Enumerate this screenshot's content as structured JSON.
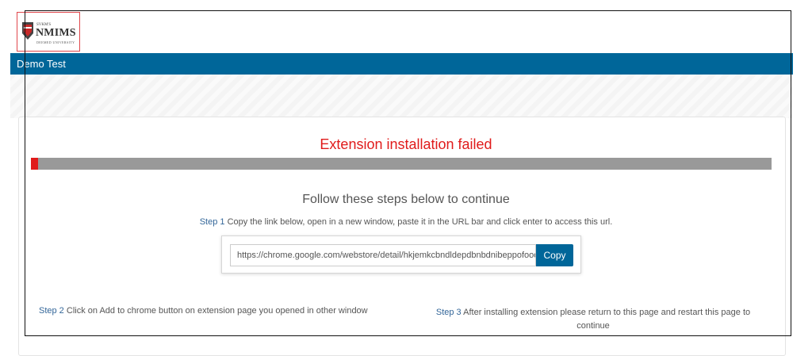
{
  "logo": {
    "small_text": "SVKM'S",
    "name": "NMIMS",
    "subtitle": "DEEMED UNIVERSITY"
  },
  "header": {
    "title": "Demo Test"
  },
  "status": {
    "heading": "Extension installation failed",
    "progress_fraction": 0.01
  },
  "instructions": {
    "heading": "Follow these steps below to continue",
    "step1_label": "Step 1",
    "step1_text": " Copy the link below, open in a new window, paste it in the URL bar and click enter to access this url.",
    "url_value": "https://chrome.google.com/webstore/detail/hkjemkcbndldepdbnbdnibeppofoooio",
    "copy_label": "Copy",
    "step2_label": "Step 2",
    "step2_text": " Click on Add to chrome button on extension page you opened in other window",
    "step3_label": "Step 3",
    "step3_text": " After installing extension please return to this page and restart this page to continue"
  },
  "colors": {
    "header_bg": "#006699",
    "error": "#e01b1b",
    "step_label": "#336699"
  }
}
